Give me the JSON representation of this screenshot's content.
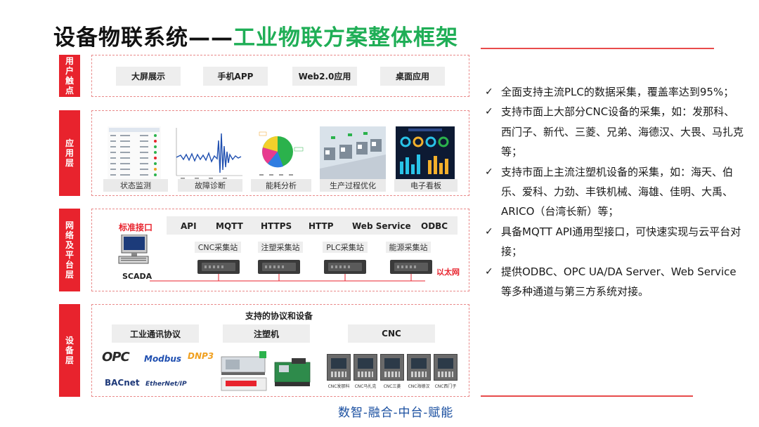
{
  "title": {
    "main": "设备物联系统——",
    "highlight": "工业物联方案整体框架"
  },
  "layers": {
    "user": {
      "label": "用户触点",
      "items": [
        "大屏展示",
        "手机APP",
        "Web2.0应用",
        "桌面应用"
      ]
    },
    "app": {
      "label": "应用层",
      "items": [
        "状态监测",
        "故障诊断",
        "能耗分析",
        "生产过程优化",
        "电子看板"
      ]
    },
    "network": {
      "label": "网络及平台层",
      "std_interface": "标准接口",
      "protocols": [
        "API",
        "MQTT",
        "HTTPS",
        "HTTP",
        "Web Service",
        "ODBC"
      ],
      "stations": [
        "CNC采集站",
        "注塑采集站",
        "PLC采集站",
        "能源采集站"
      ],
      "scada": "SCADA",
      "ethernet": "以太网"
    },
    "device": {
      "label": "设备层",
      "heading": "支持的协议和设备",
      "categories": [
        "工业通讯协议",
        "注塑机",
        "CNC"
      ],
      "logos": [
        "OPC",
        "Modbus",
        "DNP3",
        "BACnet",
        "EtherNet/IP"
      ],
      "cnc_labels": [
        "CNC发那科",
        "CNC马扎克",
        "CNC三菱",
        "CNC海德汉",
        "CNC西门子"
      ]
    }
  },
  "bullets": [
    "全面支持主流PLC的数据采集，覆盖率达到95%；",
    "支持市面上大部分CNC设备的采集，如：发那科、西门子、新代、三菱、兄弟、海德汉、大畏、马扎克等；",
    "支持市面上主流注塑机设备的采集，如：海天、伯乐、爱科、力劲、丰铁机械、海雄、佳明、大禹、ARICO（台湾长新）等；",
    "具备MQTT API通用型接口，可快速实现与云平台对接；",
    "提供ODBC、OPC UA/DA Server、Web Service等多种通道与第三方系统对接。"
  ],
  "check_mark": "✓",
  "slogan": "数智-融合-中台-赋能",
  "colors": {
    "red": "#e8232d",
    "green": "#1fae56",
    "blue": "#1a4fa0"
  }
}
